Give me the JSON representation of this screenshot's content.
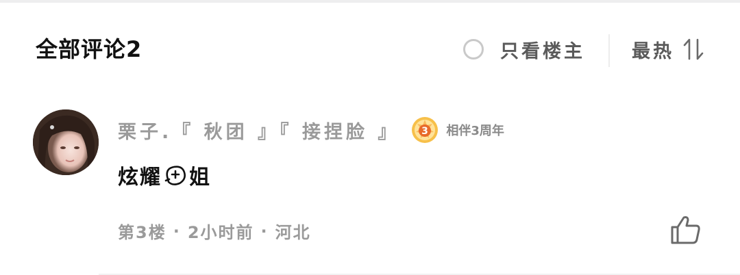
{
  "header": {
    "title": "全部评论2",
    "filter_label": "只看楼主",
    "sort_label": "最热",
    "icons": {
      "filter": "radio-circle-icon",
      "sort": "sort-arrows-icon"
    }
  },
  "comment": {
    "username": "栗子.『 秋团 』『 接捏脸 』",
    "badge": {
      "number": "3",
      "label": "相伴3周年",
      "icon": "anniversary-medal-icon"
    },
    "text_before": "炫耀",
    "sticker_icon": "emoji-sticker-icon",
    "text_after": "姐",
    "floor": "第3楼",
    "time": "2小时前",
    "location": "河北",
    "like_icon": "thumbs-up-icon"
  },
  "colors": {
    "title": "#111111",
    "secondary": "#5a5a5a",
    "meta": "#9a9a9a",
    "badge_orange": "#f0a020"
  }
}
